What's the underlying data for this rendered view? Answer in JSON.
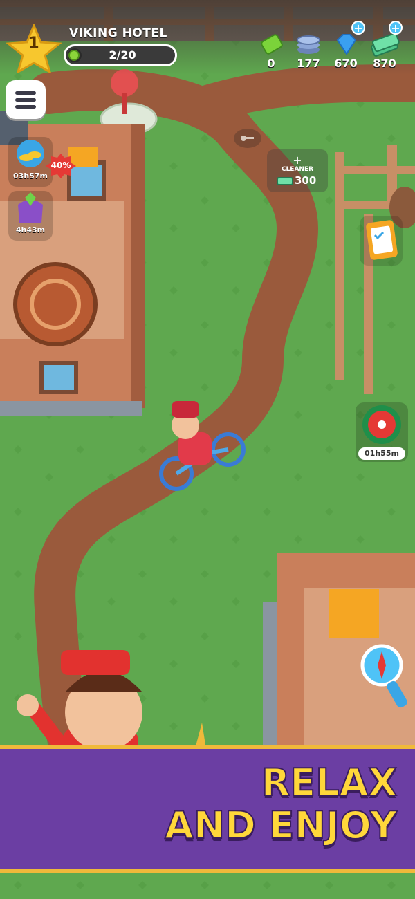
{
  "hud": {
    "level": "1",
    "hotel_name": "VIKING HOTEL",
    "progress_text": "2/20",
    "progress_fraction": 0.1
  },
  "resources": [
    {
      "name": "ticket",
      "value": "0",
      "icon": "green-ticket-icon",
      "has_plus": false
    },
    {
      "name": "coins",
      "value": "177",
      "icon": "coin-stack-icon",
      "has_plus": false
    },
    {
      "name": "gems",
      "value": "670",
      "icon": "blue-gem-icon",
      "has_plus": true
    },
    {
      "name": "cash",
      "value": "870",
      "icon": "cash-stack-icon",
      "has_plus": true
    }
  ],
  "side_offers": [
    {
      "timer": "03h57m",
      "icon": "coin-bundle-icon",
      "badge": "40%"
    },
    {
      "timer": "4h43m",
      "icon": "gem-bag-icon"
    }
  ],
  "cleaner_offer": {
    "plus": "+",
    "title": "CLEANER",
    "cost": "300"
  },
  "bonus": {
    "timer": "01h55m",
    "icon": "film-reel-icon"
  },
  "banner": {
    "line1": "RELAX",
    "line2": "AND ENJOY"
  },
  "colors": {
    "grass": "#5fa84f",
    "path": "#9a5a3c",
    "banner_purple": "#6b3ea3",
    "banner_text": "#ffd73a"
  }
}
